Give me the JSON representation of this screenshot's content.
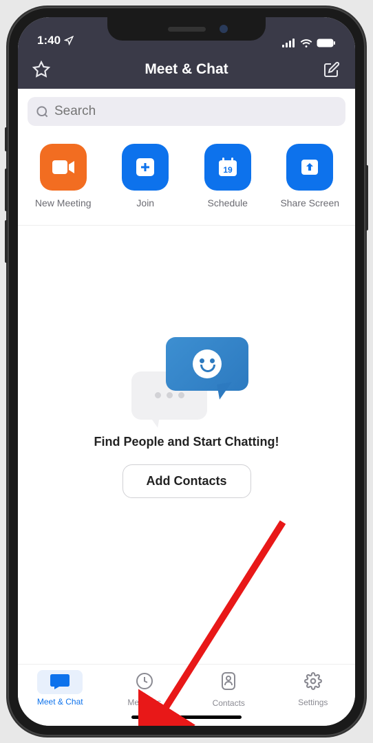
{
  "status": {
    "time": "1:40"
  },
  "header": {
    "title": "Meet & Chat"
  },
  "search": {
    "placeholder": "Search"
  },
  "actions": [
    {
      "label": "New Meeting",
      "icon": "video",
      "color": "orange"
    },
    {
      "label": "Join",
      "icon": "plus",
      "color": "blue"
    },
    {
      "label": "Schedule",
      "icon": "calendar",
      "calendar_day": "19",
      "color": "blue"
    },
    {
      "label": "Share Screen",
      "icon": "upload",
      "color": "blue"
    }
  ],
  "empty_state": {
    "title": "Find People and Start Chatting!",
    "cta": "Add Contacts"
  },
  "tabs": [
    {
      "label": "Meet & Chat",
      "icon": "chat",
      "active": true
    },
    {
      "label": "Meetings",
      "icon": "clock",
      "active": false
    },
    {
      "label": "Contacts",
      "icon": "person",
      "active": false
    },
    {
      "label": "Settings",
      "icon": "gear",
      "active": false
    }
  ],
  "annotation": {
    "arrow_points_to": "Meetings tab"
  }
}
